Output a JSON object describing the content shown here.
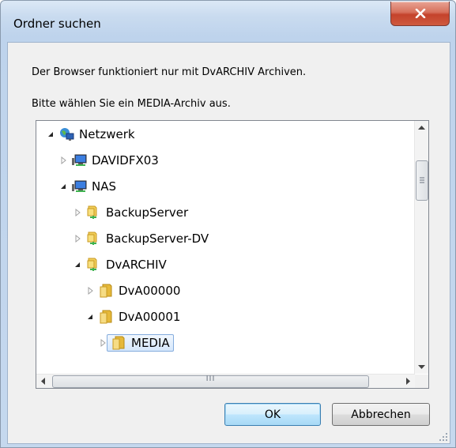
{
  "window": {
    "title": "Ordner suchen",
    "close_label": "x"
  },
  "dialog": {
    "message1": "Der Browser funktioniert nur mit DvARCHIV Archiven.",
    "message2": "Bitte wählen Sie ein MEDIA-Archiv aus."
  },
  "tree": {
    "items": [
      {
        "label": "Netzwerk",
        "icon": "network-icon",
        "state": "expanded"
      },
      {
        "label": "DAVIDFX03",
        "icon": "computer-icon",
        "state": "collapsed"
      },
      {
        "label": "NAS",
        "icon": "computer-icon",
        "state": "expanded"
      },
      {
        "label": "BackupServer",
        "icon": "shared-folder-icon",
        "state": "collapsed"
      },
      {
        "label": "BackupServer-DV",
        "icon": "shared-folder-icon",
        "state": "collapsed"
      },
      {
        "label": "DvARCHIV",
        "icon": "shared-folder-icon",
        "state": "expanded"
      },
      {
        "label": "DvA00000",
        "icon": "folder-icon",
        "state": "collapsed"
      },
      {
        "label": "DvA00001",
        "icon": "folder-icon",
        "state": "expanded"
      },
      {
        "label": "MEDIA",
        "icon": "folder-icon",
        "state": "collapsed",
        "selected": true
      }
    ],
    "hscroll_thumb_glyph": "III"
  },
  "buttons": {
    "ok": "OK",
    "cancel": "Abbrechen"
  },
  "colors": {
    "close_red": "#c4422b",
    "selection_border": "#84acdd",
    "default_button_border": "#3c7fb1"
  }
}
